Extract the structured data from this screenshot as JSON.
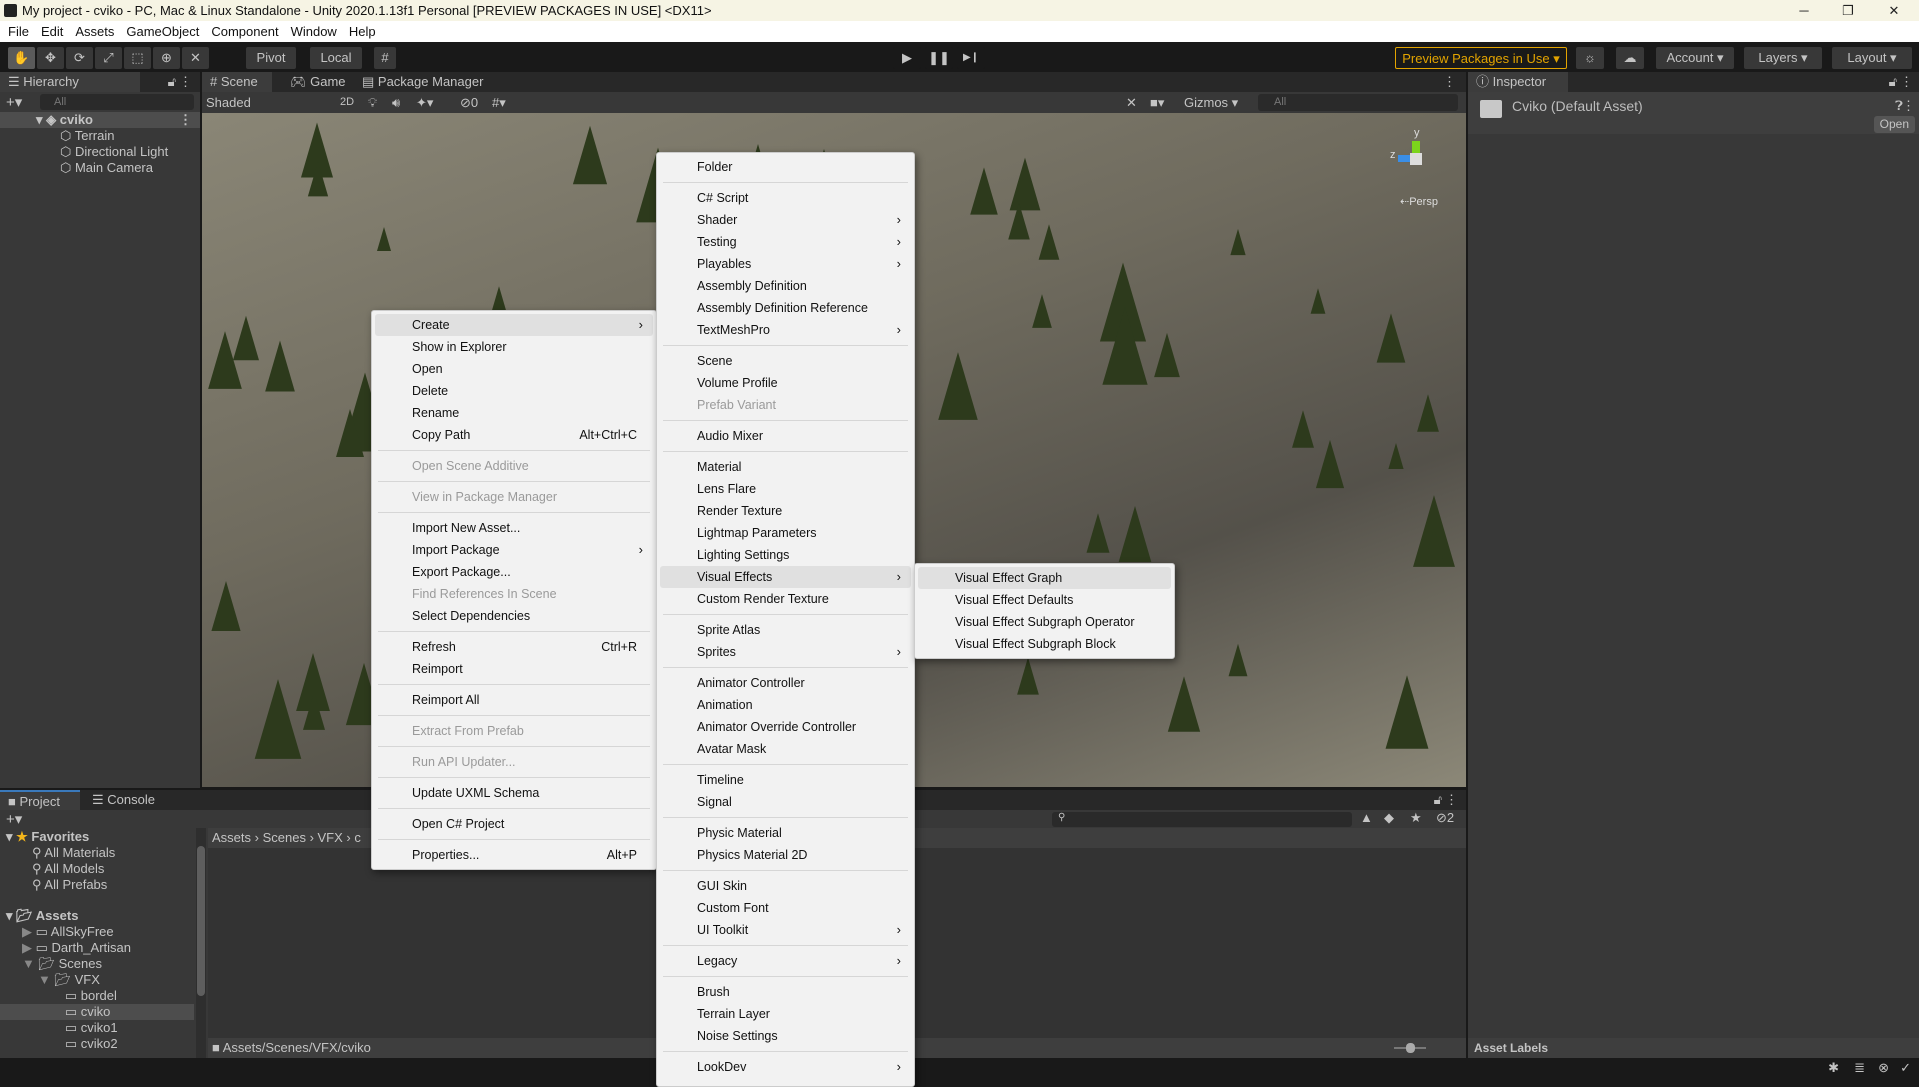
{
  "window": {
    "title": "My project - cviko - PC, Mac & Linux Standalone - Unity 2020.1.13f1 Personal [PREVIEW PACKAGES IN USE] <DX11>",
    "minimize": "─",
    "maximize": "❐",
    "close": "✕"
  },
  "menubar": [
    "File",
    "Edit",
    "Assets",
    "GameObject",
    "Component",
    "Window",
    "Help"
  ],
  "toolbar": {
    "pivot": "Pivot",
    "local": "Local",
    "preview_packages": "Preview Packages in Use ▾",
    "account": "Account ▾",
    "layers": "Layers ▾",
    "layout": "Layout ▾",
    "play": "▶",
    "pause": "❚❚",
    "step": "▶❙",
    "accent": "#e3a400"
  },
  "hierarchy": {
    "tab": "Hierarchy",
    "search_placeholder": "All",
    "scene": "cviko",
    "items": [
      "Terrain",
      "Directional Light",
      "Main Camera"
    ]
  },
  "scene": {
    "tabs": [
      "Scene",
      "Game",
      "Package Manager"
    ],
    "shading": "Shaded",
    "mode_2d": "2D",
    "hidden_count": "0",
    "gizmos": "Gizmos",
    "search_placeholder": "All",
    "persp": "Persp",
    "axis_y": "y",
    "axis_z": "z"
  },
  "inspector": {
    "tab": "Inspector",
    "asset": "Cviko (Default Asset)",
    "open": "Open",
    "asset_labels": "Asset Labels"
  },
  "project": {
    "tabs": [
      "Project",
      "Console"
    ],
    "favorites": "Favorites",
    "fav_items": [
      "All Materials",
      "All Models",
      "All Prefabs"
    ],
    "assets": "Assets",
    "tree": [
      {
        "label": "AllSkyFree",
        "depth": 1,
        "arrow": "▶"
      },
      {
        "label": "Darth_Artisan",
        "depth": 1,
        "arrow": "▶"
      },
      {
        "label": "Scenes",
        "depth": 1,
        "arrow": "▼"
      },
      {
        "label": "VFX",
        "depth": 2,
        "arrow": "▼"
      },
      {
        "label": "bordel",
        "depth": 3,
        "arrow": ""
      },
      {
        "label": "cviko",
        "depth": 3,
        "arrow": "",
        "selected": true
      },
      {
        "label": "cviko1",
        "depth": 3,
        "arrow": ""
      },
      {
        "label": "cviko2",
        "depth": 3,
        "arrow": ""
      }
    ],
    "breadcrumb": [
      "Assets",
      "Scenes",
      "VFX",
      "c"
    ],
    "path": "Assets/Scenes/VFX/cviko",
    "hidden_count": "2"
  },
  "context_menu": [
    {
      "label": "Create",
      "sub": true,
      "hl": true
    },
    {
      "label": "Show in Explorer"
    },
    {
      "label": "Open"
    },
    {
      "label": "Delete"
    },
    {
      "label": "Rename"
    },
    {
      "label": "Copy Path",
      "shortcut": "Alt+Ctrl+C"
    },
    {
      "sep": true
    },
    {
      "label": "Open Scene Additive",
      "dis": true
    },
    {
      "sep": true
    },
    {
      "label": "View in Package Manager",
      "dis": true
    },
    {
      "sep": true
    },
    {
      "label": "Import New Asset..."
    },
    {
      "label": "Import Package",
      "sub": true
    },
    {
      "label": "Export Package..."
    },
    {
      "label": "Find References In Scene",
      "dis": true
    },
    {
      "label": "Select Dependencies"
    },
    {
      "sep": true
    },
    {
      "label": "Refresh",
      "shortcut": "Ctrl+R"
    },
    {
      "label": "Reimport"
    },
    {
      "sep": true
    },
    {
      "label": "Reimport All"
    },
    {
      "sep": true
    },
    {
      "label": "Extract From Prefab",
      "dis": true
    },
    {
      "sep": true
    },
    {
      "label": "Run API Updater...",
      "dis": true
    },
    {
      "sep": true
    },
    {
      "label": "Update UXML Schema"
    },
    {
      "sep": true
    },
    {
      "label": "Open C# Project"
    },
    {
      "sep": true
    },
    {
      "label": "Properties...",
      "shortcut": "Alt+P"
    }
  ],
  "create_menu": [
    {
      "label": "Folder"
    },
    {
      "sep": true
    },
    {
      "label": "C# Script"
    },
    {
      "label": "Shader",
      "sub": true
    },
    {
      "label": "Testing",
      "sub": true
    },
    {
      "label": "Playables",
      "sub": true
    },
    {
      "label": "Assembly Definition"
    },
    {
      "label": "Assembly Definition Reference"
    },
    {
      "label": "TextMeshPro",
      "sub": true
    },
    {
      "sep": true
    },
    {
      "label": "Scene"
    },
    {
      "label": "Volume Profile"
    },
    {
      "label": "Prefab Variant",
      "dis": true
    },
    {
      "sep": true
    },
    {
      "label": "Audio Mixer"
    },
    {
      "sep": true
    },
    {
      "label": "Material"
    },
    {
      "label": "Lens Flare"
    },
    {
      "label": "Render Texture"
    },
    {
      "label": "Lightmap Parameters"
    },
    {
      "label": "Lighting Settings"
    },
    {
      "label": "Visual Effects",
      "sub": true,
      "hl": true
    },
    {
      "label": "Custom Render Texture"
    },
    {
      "sep": true
    },
    {
      "label": "Sprite Atlas"
    },
    {
      "label": "Sprites",
      "sub": true
    },
    {
      "sep": true
    },
    {
      "label": "Animator Controller"
    },
    {
      "label": "Animation"
    },
    {
      "label": "Animator Override Controller"
    },
    {
      "label": "Avatar Mask"
    },
    {
      "sep": true
    },
    {
      "label": "Timeline"
    },
    {
      "label": "Signal"
    },
    {
      "sep": true
    },
    {
      "label": "Physic Material"
    },
    {
      "label": "Physics Material 2D"
    },
    {
      "sep": true
    },
    {
      "label": "GUI Skin"
    },
    {
      "label": "Custom Font"
    },
    {
      "label": "UI Toolkit",
      "sub": true
    },
    {
      "sep": true
    },
    {
      "label": "Legacy",
      "sub": true
    },
    {
      "sep": true
    },
    {
      "label": "Brush"
    },
    {
      "label": "Terrain Layer"
    },
    {
      "label": "Noise Settings"
    },
    {
      "sep": true
    },
    {
      "label": "LookDev",
      "sub": true
    }
  ],
  "vfx_menu": [
    {
      "label": "Visual Effect Graph",
      "hl": true
    },
    {
      "label": "Visual Effect Defaults"
    },
    {
      "label": "Visual Effect Subgraph Operator"
    },
    {
      "label": "Visual Effect Subgraph Block"
    }
  ]
}
